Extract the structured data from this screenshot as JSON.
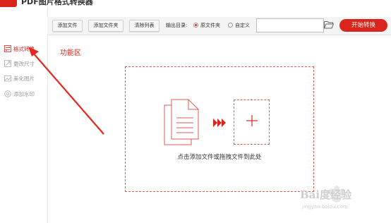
{
  "app": {
    "title": "PDF图片格式转换器"
  },
  "sidebar": {
    "items": [
      {
        "label": "格式转换",
        "icon": "convert-icon",
        "active": true
      },
      {
        "label": "更改尺寸",
        "icon": "resize-icon",
        "active": false
      },
      {
        "label": "美化图片",
        "icon": "beautify-icon",
        "active": false
      },
      {
        "label": "添加水印",
        "icon": "watermark-icon",
        "active": false
      }
    ]
  },
  "toolbar": {
    "add_file": "添加文件",
    "add_folder": "添加文件夹",
    "clear_list": "清除列表",
    "output_dir_label": "输出目录:",
    "radio_source": "原文件夹",
    "radio_custom": "自定义",
    "selected_output": "原文件夹",
    "path_value": "",
    "start_button": "开始转换"
  },
  "main": {
    "section_title": "功能区",
    "drop_hint": "点击添加文件或拖拽文件到此处"
  },
  "watermark": {
    "text": "Bai度经验",
    "url": "jingyan.baidu.com"
  },
  "colors": {
    "accent": "#d9251d",
    "dashed_border": "#e05a54"
  }
}
